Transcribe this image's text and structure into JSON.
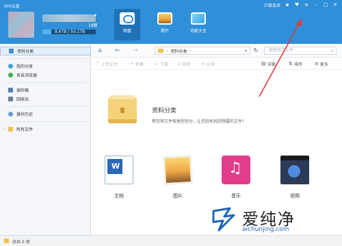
{
  "header": {
    "app_title": "360云盘",
    "user_caret": "▾",
    "level": "19级",
    "storage_text": "8.6TB / 50.1TB",
    "storage_used_fraction": 0.17,
    "tabs": [
      {
        "label": "网盘",
        "icon": "cloud-icon",
        "active": true
      },
      {
        "label": "照片",
        "icon": "photo-icon",
        "active": false
      },
      {
        "label": "功能大全",
        "icon": "feature-icon",
        "active": false
      }
    ],
    "upgrade_label": "升级会员"
  },
  "breadcrumb": {
    "path": "资料分类",
    "search_placeholder": "搜索您的文件"
  },
  "toolbar": {
    "upload": "上传文件",
    "new": "新建",
    "download": "下载",
    "delete": "删除",
    "share": "分享",
    "detail": "详细",
    "sort": "排序",
    "more": "更多"
  },
  "sidebar": {
    "items": [
      {
        "label": "资料分类",
        "active": true
      },
      {
        "label": "我的分享"
      },
      {
        "label": "来自浏览器"
      },
      {
        "label": "保险箱"
      },
      {
        "label": "回收站"
      },
      {
        "label": "操作历史"
      },
      {
        "label": "所有文件"
      }
    ]
  },
  "main": {
    "title": "资料分类",
    "description": "帮您将文件按类型划分，让您轻松找到想要的文件！",
    "tiles": [
      {
        "label": "文档",
        "icon": "document-icon"
      },
      {
        "label": "图片",
        "icon": "picture-icon"
      },
      {
        "label": "音乐",
        "icon": "music-icon"
      },
      {
        "label": "视频",
        "icon": "video-icon"
      }
    ]
  },
  "status": {
    "text": "总共 0 项"
  },
  "watermark": {
    "chinese": "爱纯净",
    "url": "aichunjing.com"
  },
  "colors": {
    "header_bg": "#2f8fd8",
    "arrow": "#e03a3a"
  }
}
